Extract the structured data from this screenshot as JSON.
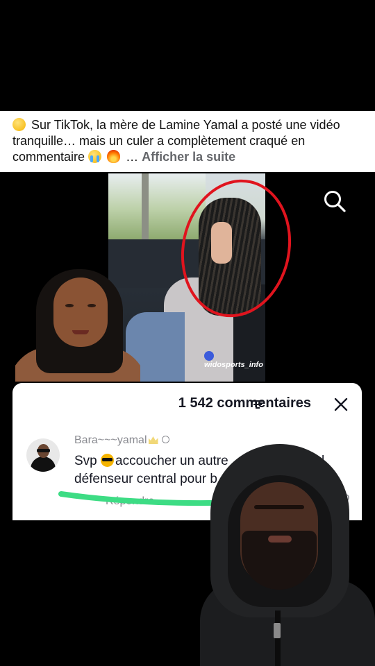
{
  "post": {
    "caption": "Sur TikTok, la mère de Lamine Yamal a posté une vidéo tranquille… mais un culer a complètement craqué en commentaire",
    "ellipsis": "…",
    "see_more": "Afficher la suite",
    "emojis": [
      "rofl-emoji",
      "loudly-crying-emoji",
      "fire-emoji"
    ]
  },
  "video": {
    "watermark": "widosports_info",
    "highlight_color": "#e0141e"
  },
  "comments_panel": {
    "count_label": "1 542 commentaires",
    "comment": {
      "username": "Bara~~~yamal",
      "text_before_emoji": "Svp",
      "text_after_emoji": "accoucher un autre ",
      "text_hidden_tail": "amal",
      "line2": "défenseur central pour b",
      "reply_label": "Répondre"
    },
    "underline_color": "#3ddc84"
  }
}
